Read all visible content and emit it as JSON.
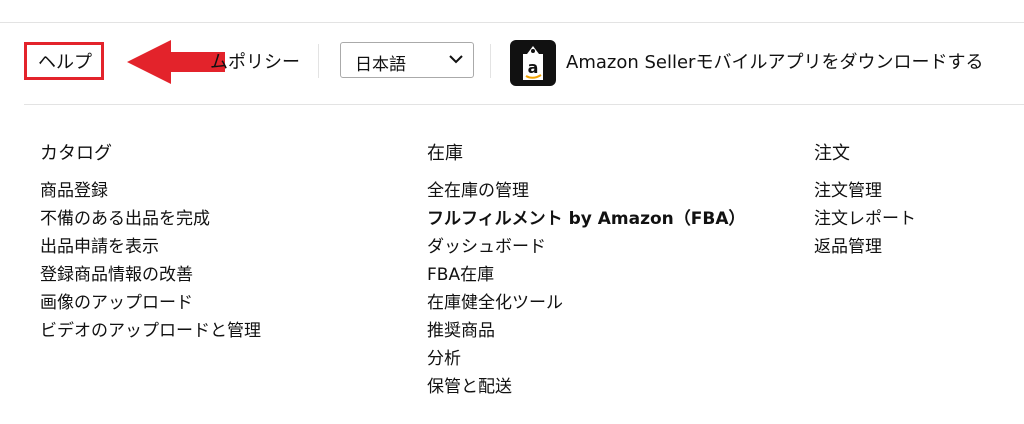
{
  "toolbar": {
    "help_label": "ヘルプ",
    "policy_label": "ムポリシー",
    "language": {
      "selected": "日本語"
    },
    "app_download_label": "Amazon Sellerモバイルアプリをダウンロードする",
    "app_icon_letter": "a"
  },
  "colors": {
    "highlight": "#e3232b",
    "arrow": "#e3232b",
    "app_icon_bg": "#111111",
    "app_icon_tag": "#ffffff"
  },
  "columns": {
    "catalog": {
      "heading": "カタログ",
      "items": [
        "商品登録",
        "不備のある出品を完成",
        "出品申請を表示",
        "登録商品情報の改善",
        "画像のアップロード",
        "ビデオのアップロードと管理"
      ]
    },
    "inventory": {
      "heading": "在庫",
      "items": [
        "全在庫の管理",
        "フルフィルメント by Amazon（FBA）",
        "ダッシュボード",
        "FBA在庫",
        "在庫健全化ツール",
        "推奨商品",
        "分析",
        "保管と配送"
      ]
    },
    "orders": {
      "heading": "注文",
      "items": [
        "注文管理",
        "注文レポート",
        "返品管理"
      ]
    }
  }
}
